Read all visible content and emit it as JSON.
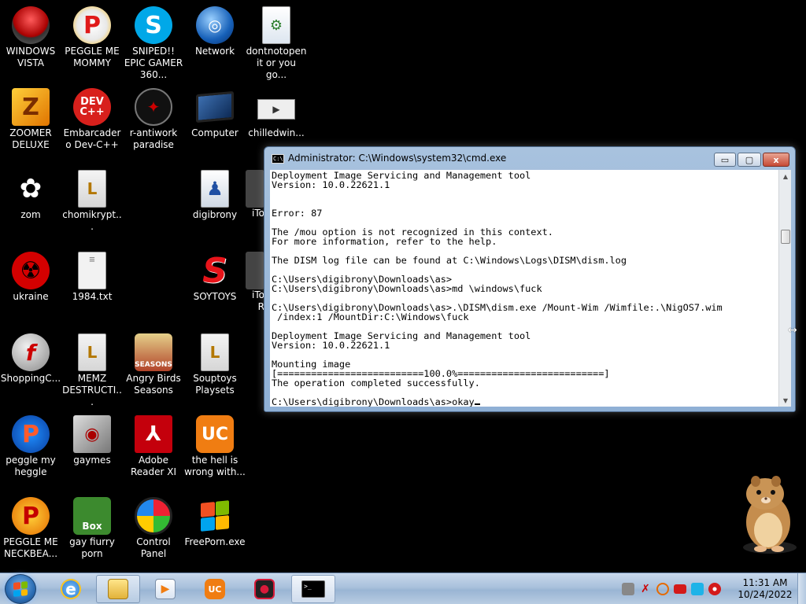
{
  "desktop": {
    "icons": [
      {
        "label": "WINDOWS VISTA",
        "icon": "robot-pod-icon"
      },
      {
        "label": "PEGGLE ME MOMMY",
        "icon": "peggle-icon"
      },
      {
        "label": "SNIPED!! EPIC GAMER 360...",
        "icon": "skype-icon"
      },
      {
        "label": "Network",
        "icon": "network-globe-icon"
      },
      {
        "label": "dontnotopen it or you go...",
        "icon": "script-file-icon"
      },
      {
        "label": "ZOOMER DELUXE",
        "icon": "zuma-icon"
      },
      {
        "label": "Embarcadero Dev-C++",
        "icon": "devcpp-icon"
      },
      {
        "label": "r-antiwork paradise",
        "icon": "dark-badge-icon"
      },
      {
        "label": "Computer",
        "icon": "computer-icon"
      },
      {
        "label": "chilledwin...",
        "icon": "video-file-icon"
      },
      {
        "label": "zom",
        "icon": "flower-icon"
      },
      {
        "label": "chomikrypt...",
        "icon": "document-l-icon"
      },
      {
        "label": "digibrony",
        "icon": "user-folder-icon"
      },
      {
        "label": "iTo",
        "icon": "partial-icon"
      },
      {
        "label": "ukraine",
        "icon": "radiation-icon"
      },
      {
        "label": "1984.txt",
        "icon": "text-file-icon"
      },
      {
        "label": "SOYTOYS",
        "icon": "red-s-icon"
      },
      {
        "label": "iTo R",
        "icon": "partial-icon"
      },
      {
        "label": "ShoppingC...",
        "icon": "flash-icon"
      },
      {
        "label": "MEMZ DESTRUCTI...",
        "icon": "document-l-icon"
      },
      {
        "label": "Angry Birds Seasons",
        "icon": "angry-birds-icon"
      },
      {
        "label": "Souptoys Playsets",
        "icon": "document-l-icon"
      },
      {
        "label": "peggle my heggle",
        "icon": "peggle-icon"
      },
      {
        "label": "gaymes",
        "icon": "media-folder-icon"
      },
      {
        "label": "Adobe Reader XI",
        "icon": "adobe-reader-icon"
      },
      {
        "label": "the hell is wrong with...",
        "icon": "uc-browser-icon"
      },
      {
        "label": "PEGGLE ME NECKBEA...",
        "icon": "peggle-icon"
      },
      {
        "label": "gay fiurry porn",
        "icon": "hamster-box-icon"
      },
      {
        "label": "Control Panel",
        "icon": "control-panel-icon"
      },
      {
        "label": "FreePorn.exe",
        "icon": "windows-flag-icon"
      }
    ]
  },
  "cmd": {
    "title": "Administrator: C:\\Windows\\system32\\cmd.exe",
    "title_icon": "C:\\",
    "minimize": "▭",
    "maximize": "▢",
    "close": "x",
    "lines": [
      "Deployment Image Servicing and Management tool",
      "Version: 10.0.22621.1",
      "",
      "",
      "Error: 87",
      "",
      "The /mou option is not recognized in this context.",
      "For more information, refer to the help.",
      "",
      "The DISM log file can be found at C:\\Windows\\Logs\\DISM\\dism.log",
      "",
      "C:\\Users\\digibrony\\Downloads\\as>",
      "C:\\Users\\digibrony\\Downloads\\as>md \\windows\\fuck",
      "",
      "C:\\Users\\digibrony\\Downloads\\as>.\\DISM\\dism.exe /Mount-Wim /Wimfile:.\\NigOS7.wim",
      " /index:1 /MountDir:C:\\Windows\\fuck",
      "",
      "Deployment Image Servicing and Management tool",
      "Version: 10.0.22621.1",
      "",
      "Mounting image",
      "[==========================100.0%==========================]",
      "The operation completed successfully.",
      "",
      "C:\\Users\\digibrony\\Downloads\\as>okay"
    ]
  },
  "taskbar": {
    "clock_time": "11:31 AM",
    "clock_date": "10/24/2022",
    "pinned": [
      {
        "name": "internet-explorer",
        "icon": "ie-icon"
      },
      {
        "name": "windows-explorer",
        "icon": "folder-icon"
      },
      {
        "name": "media-player",
        "icon": "media-player-icon"
      },
      {
        "name": "uc-browser",
        "icon": "uc-browser-icon"
      },
      {
        "name": "screen-recorder",
        "icon": "camera-recorder-icon"
      },
      {
        "name": "command-prompt",
        "icon": "cmd-icon"
      }
    ]
  },
  "colors": {
    "accent": "#2b6db4",
    "close_button": "#c74a35",
    "titlebar": "#a8c2de"
  }
}
